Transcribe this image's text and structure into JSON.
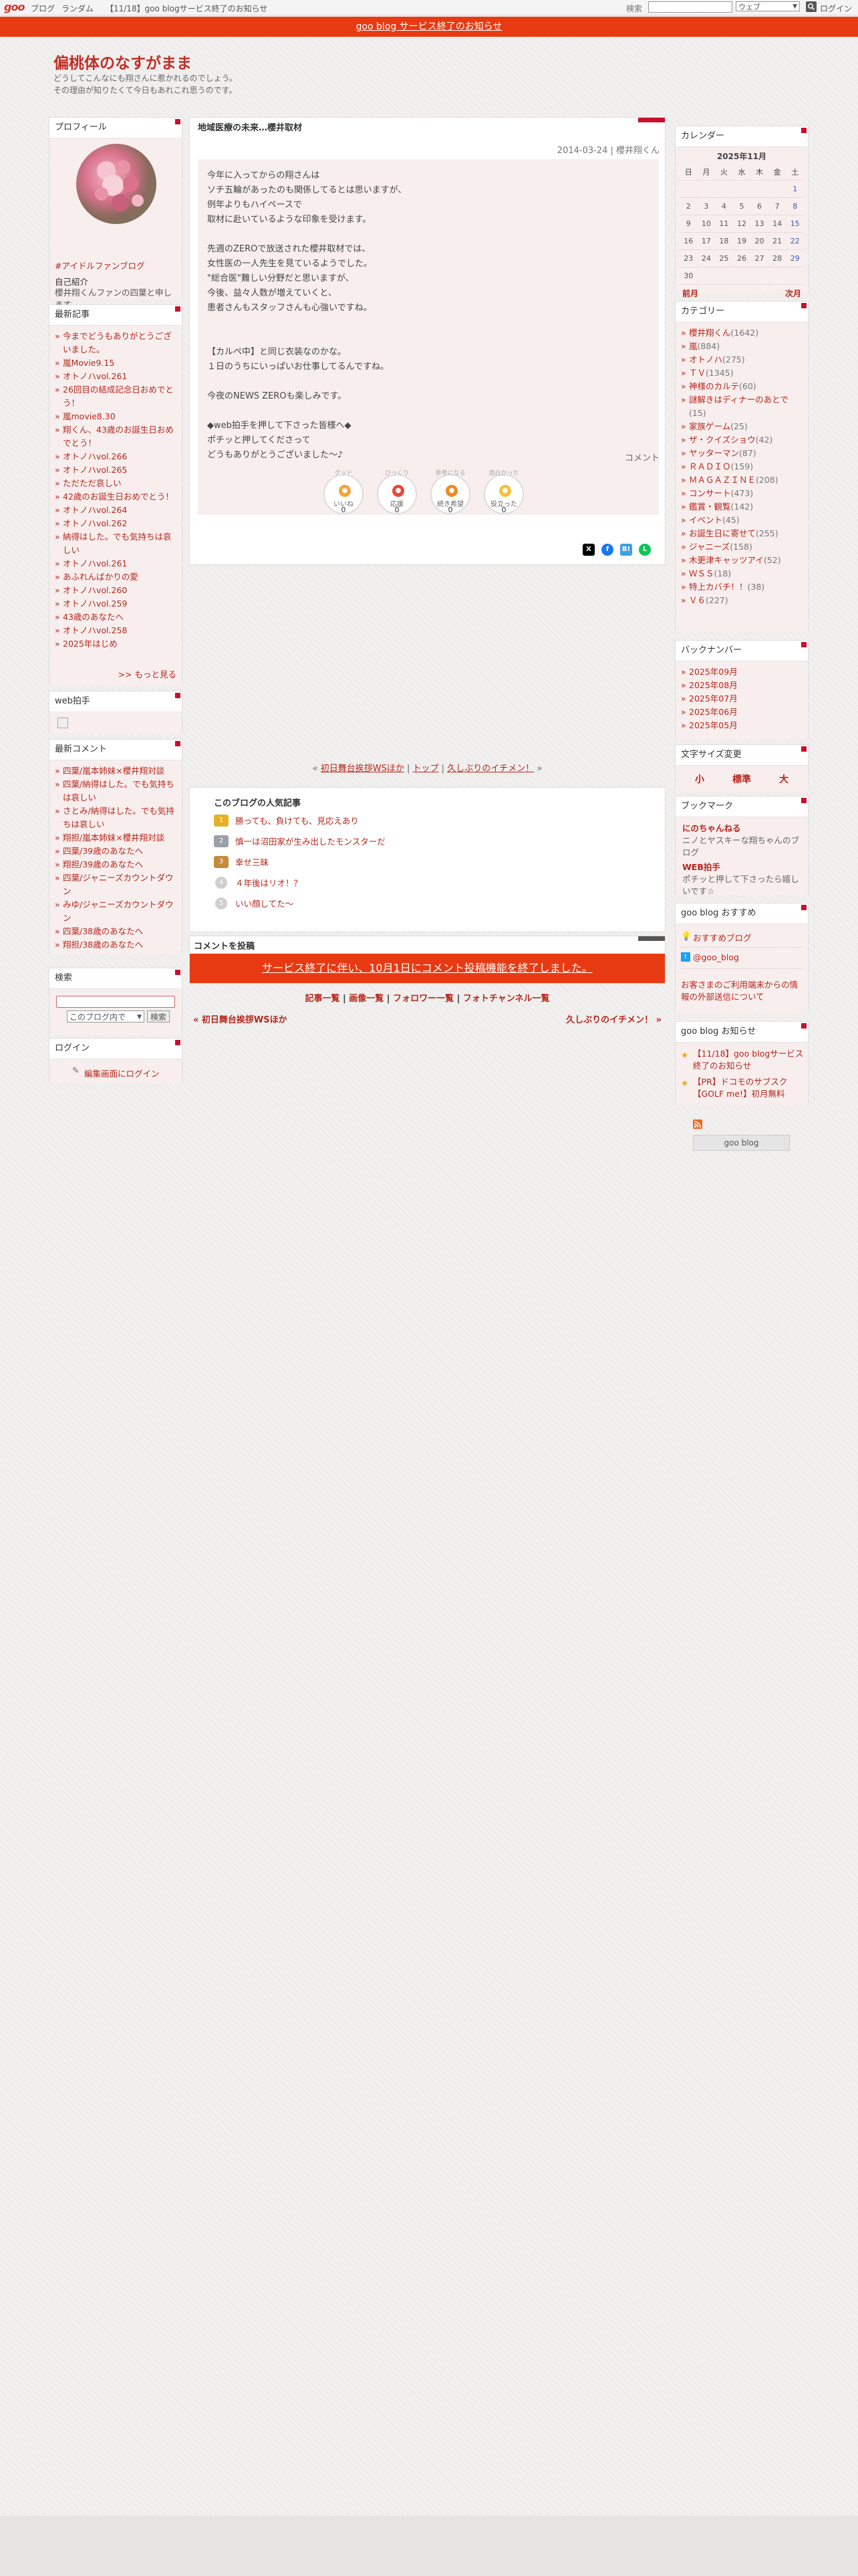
{
  "topbar": {
    "logo": "goo",
    "links": [
      "ブログ",
      "ランダム",
      "【11/18】goo blogサービス終了のお知らせ"
    ],
    "search_label": "検索",
    "search_placeholder": "",
    "search_select": "ウェブ",
    "search_icon": "search-icon",
    "login": "ログイン"
  },
  "notice": "goo blog サービス終了のお知らせ",
  "blog": {
    "title": "偏桃体のなすがまま",
    "desc1": "どうしてこんなにも翔さんに惹かれるのでしょう。",
    "desc2": "その理由が知りたくて今日もあれこれ思うのです。"
  },
  "profile": {
    "head": "プロフィール",
    "link": "#アイドルファンブログ",
    "intro_head": "自己紹介",
    "intro_text": "櫻井翔くんファンの四葉と申します。"
  },
  "recent": {
    "head": "最新記事",
    "items": [
      "今までどうもありがとうございました。",
      "嵐Movie9.15",
      "オトノハvol.261",
      "26回目の結成記念日おめでとう！",
      "嵐movie8.30",
      "翔くん、43歳のお誕生日おめでとう！",
      "オトノハvol.266",
      "オトノハvol.265",
      "ただただ哀しい",
      "42歳のお誕生日おめでとう！",
      "オトノハvol.264",
      "オトノハvol.262",
      "納得はした。でも気持ちは哀しい",
      "オトノハvol.261",
      "あふれんばかりの愛",
      "オトノハvol.260",
      "オトノハvol.259",
      "43歳のあなたへ",
      "オトノハvol.258",
      "2025年はじめ"
    ],
    "more": ">> もっと見る"
  },
  "web_teshu": {
    "head": "web拍手"
  },
  "recent_comments": {
    "head": "最新コメント",
    "items": [
      "四葉/嵐本姉妹×櫻井翔対談",
      "四葉/納得はした。でも気持ちは哀しい",
      "さとみ/納得はした。でも気持ちは哀しい",
      "翔担/嵐本姉妹×櫻井翔対談",
      "四葉/39歳のあなたへ",
      "翔担/39歳のあなたへ",
      "四葉/ジャニーズカウントダウン",
      "みゆ/ジャニーズカウントダウン",
      "四葉/38歳のあなたへ",
      "翔担/38歳のあなたへ"
    ]
  },
  "search_widget": {
    "head": "検索",
    "select": "このブログ内で",
    "button": "検索"
  },
  "login_widget": {
    "head": "ログイン",
    "link": "編集画面にログイン"
  },
  "article": {
    "title": "地域医療の未来…櫻井取材",
    "meta": "2014-03-24 | 櫻井翔くん",
    "lines": [
      "今年に入ってからの翔さんは",
      "ソチ五輪があったのも関係してるとは思いますが、",
      "例年よりもハイペースで",
      "取材に赴いているような印象を受けます。",
      "",
      "先週のZEROで放送された櫻井取材では、",
      "女性医の一人先生を見ているようでした。",
      "\"総合医\"難しい分野だと思いますが、",
      "今後、益々人数が増えていくと、",
      "患者さんもスタッフさんも心強いですね。",
      "",
      "",
      "【カルペ中】と同じ衣装なのかな。",
      "１日のうちにいっぱいお仕事してるんですね。",
      "",
      "今夜のNEWS ZEROも楽しみです。",
      "",
      "◆web拍手を押して下さった皆様へ◆",
      "ポチッと押してくださって",
      "どうもありがとうございました〜♪"
    ],
    "comment_label": "コメント",
    "reactions": [
      {
        "top": "グッド",
        "name": "いいね",
        "count": "0",
        "icon": "thumbs-up-icon",
        "color": "#f4a43a"
      },
      {
        "top": "びっくり",
        "name": "応援",
        "count": "0",
        "icon": "megaphone-icon",
        "color": "#e8483c"
      },
      {
        "top": "参考になる",
        "name": "続き希望",
        "count": "0",
        "icon": "heart-eyes-icon",
        "color": "#f08a24"
      },
      {
        "top": "面白かった",
        "name": "役立った",
        "count": "0",
        "icon": "smile-icon",
        "color": "#f4c23a"
      }
    ]
  },
  "pager": {
    "prev": "初日舞台挨拶WSほか",
    "top": "トップ",
    "next": "久しぶりのイチメン！"
  },
  "popular": {
    "title": "このブログの人気記事",
    "items": [
      "勝っても、負けても、見応えあり",
      "慎一は沼田家が生み出したモンスターだ",
      "幸せ三昧",
      "４年後はリオ！？",
      "いい顔してた〜"
    ],
    "colors": [
      "#e5b12a",
      "#9aa0a8",
      "#c58a3c",
      "#cfcfcf",
      "#cfcfcf"
    ],
    "marks": [
      "1",
      "2",
      "3",
      "4",
      "5"
    ]
  },
  "comment_post": {
    "title": "コメントを投稿",
    "bar": "サービス終了に伴い、10月1日にコメント投稿機能を終了しました。"
  },
  "links": [
    "記事一覧",
    "画像一覧",
    "フォロワー一覧",
    "フォトチャンネル一覧"
  ],
  "prevnext": {
    "prev": "« 初日舞台挨拶WSほか",
    "next": "久しぶりのイチメン！ »"
  },
  "calendar": {
    "head": "カレンダー",
    "month": "2025年11月",
    "weekdays": [
      "日",
      "月",
      "火",
      "水",
      "木",
      "金",
      "土"
    ],
    "rows": [
      [
        "",
        "",
        "",
        "",
        "",
        "",
        "1"
      ],
      [
        "2",
        "3",
        "4",
        "5",
        "6",
        "7",
        "8"
      ],
      [
        "9",
        "10",
        "11",
        "12",
        "13",
        "14",
        "15"
      ],
      [
        "16",
        "17",
        "18",
        "19",
        "20",
        "21",
        "22"
      ],
      [
        "23",
        "24",
        "25",
        "26",
        "27",
        "28",
        "29"
      ],
      [
        "30",
        "",
        "",
        "",
        "",
        "",
        ""
      ]
    ],
    "prev": "前月",
    "next": "次月"
  },
  "categories": {
    "head": "カテゴリー",
    "items": [
      {
        "name": "櫻井翔くん",
        "count": "(1642)"
      },
      {
        "name": "嵐",
        "count": "(884)"
      },
      {
        "name": "オトノハ",
        "count": "(275)"
      },
      {
        "name": "ＴＶ",
        "count": "(1345)"
      },
      {
        "name": "神様のカルテ",
        "count": "(60)"
      },
      {
        "name": "謎解きはディナーのあとで",
        "count": "(15)"
      },
      {
        "name": "家族ゲーム",
        "count": "(25)"
      },
      {
        "name": "ザ・クイズショウ",
        "count": "(42)"
      },
      {
        "name": "ヤッターマン",
        "count": "(87)"
      },
      {
        "name": "ＲＡＤＩＯ",
        "count": "(159)"
      },
      {
        "name": "ＭＡＧＡＺＩＮＥ",
        "count": "(208)"
      },
      {
        "name": "コンサート",
        "count": "(473)"
      },
      {
        "name": "鑑賞・観覧",
        "count": "(142)"
      },
      {
        "name": "イベント",
        "count": "(45)"
      },
      {
        "name": "お誕生日に寄せて",
        "count": "(255)"
      },
      {
        "name": "ジャニーズ",
        "count": "(158)"
      },
      {
        "name": "木更津キャッツアイ",
        "count": "(52)"
      },
      {
        "name": "ＷＳＳ",
        "count": "(18)"
      },
      {
        "name": "特上カバチ！！",
        "count": "(38)"
      },
      {
        "name": "Ｖ６",
        "count": "(227)"
      }
    ]
  },
  "backnumber": {
    "head": "バックナンバー",
    "items": [
      "2025年09月",
      "2025年08月",
      "2025年07月",
      "2025年06月",
      "2025年05月"
    ]
  },
  "fontsize": {
    "head": "文字サイズ変更",
    "small": "小",
    "normal": "標準",
    "large": "大"
  },
  "bookmark": {
    "head": "ブックマーク",
    "items": [
      {
        "name": "にのちゃんねる",
        "desc": "ニノとヤスキーな翔ちゃんのブログ"
      },
      {
        "name": "WEB拍手",
        "desc": "ポチッと押して下さったら嬉しいです☆"
      }
    ]
  },
  "recommend": {
    "head": "goo blog おすすめ",
    "item1": "おすすめブログ",
    "item2": "@goo_blog",
    "item3": "お客さまのご利用端末からの情報の外部送信について"
  },
  "announce": {
    "head": "goo blog お知らせ",
    "items": [
      "【11/18】goo blogサービス終了のお知らせ",
      "【PR】ドコモのサブスク【GOLF me!】初月無料"
    ]
  },
  "rss_label": "RSS",
  "goo_blog_btn": "goo blog"
}
